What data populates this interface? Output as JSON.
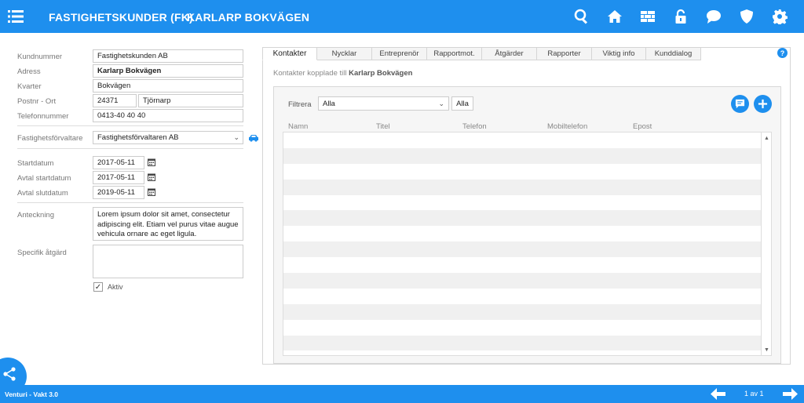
{
  "header": {
    "menu_icon": "hamburger-menu-icon",
    "title_main": "FASTIGHETSKUNDER (FK)",
    "title_sub": "KARLARP BOKVÄGEN",
    "icons": [
      "search-icon",
      "home-icon",
      "wall-icon",
      "lock-icon",
      "chat-icon",
      "shield-icon",
      "gear-icon"
    ]
  },
  "form": {
    "kundnummer": {
      "label": "Kundnummer",
      "value": "Fastighetskunden AB"
    },
    "adress": {
      "label": "Adress",
      "value": "Karlarp Bokvägen"
    },
    "kvarter": {
      "label": "Kvarter",
      "value": "Bokvägen"
    },
    "postnr_ort": {
      "label": "Postnr - Ort",
      "postnr": "24371",
      "ort": "Tjörnarp"
    },
    "telefon": {
      "label": "Telefonnummer",
      "value": "0413-40 40 40"
    },
    "forvaltare": {
      "label": "Fastighetsförvaltare",
      "value": "Fastighetsförvaltaren AB"
    },
    "startdatum": {
      "label": "Startdatum",
      "value": "2017-05-11"
    },
    "avtal_start": {
      "label": "Avtal startdatum",
      "value": "2017-05-11"
    },
    "avtal_slut": {
      "label": "Avtal slutdatum",
      "value": "2019-05-11"
    },
    "anteckning": {
      "label": "Anteckning",
      "value": "Lorem ipsum dolor sit amet, consectetur adipiscing elit. Etiam vel purus vitae augue vehicula ornare ac eget ligula."
    },
    "specifik": {
      "label": "Specifik åtgärd",
      "value": ""
    },
    "aktiv": {
      "label": "Aktiv",
      "checked": "✓"
    }
  },
  "tabs": [
    "Kontakter",
    "Nycklar",
    "Entreprenör",
    "Rapportmot.",
    "Åtgärder",
    "Rapporter",
    "Viktig info",
    "Kunddialog"
  ],
  "contacts": {
    "subtitle_prefix": "Kontakter kopplade till",
    "subtitle_name": "Karlarp Bokvägen",
    "filter_label": "Filtrera",
    "filter_value": "Alla",
    "filter_button": "Alla",
    "columns": [
      "Namn",
      "Titel",
      "Telefon",
      "Mobiltelefon",
      "Epost"
    ]
  },
  "footer": {
    "app_name": "Venturi - Vakt 3.0",
    "page_info": "1 av 1"
  },
  "colors": {
    "brand": "#1e8fee"
  }
}
